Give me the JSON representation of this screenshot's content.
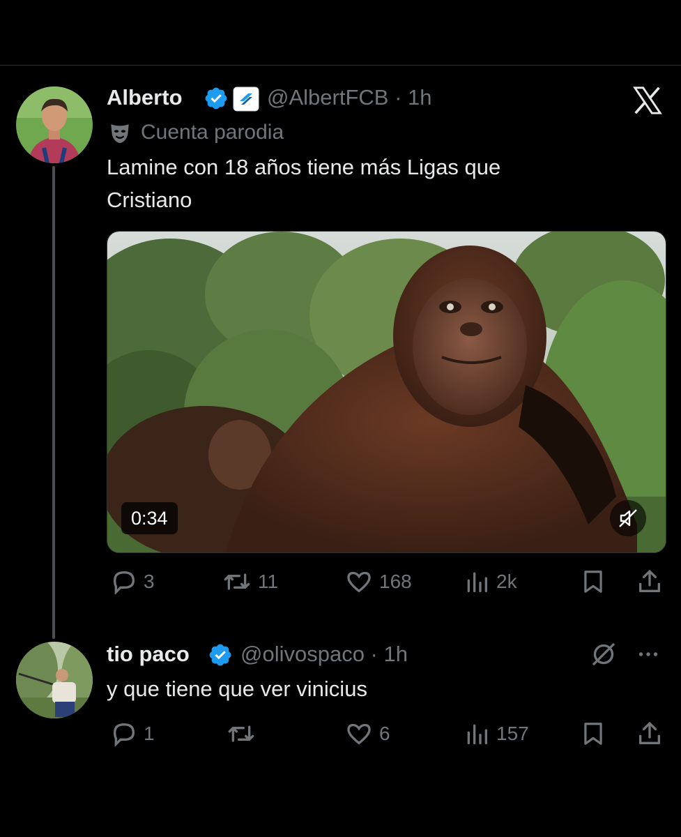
{
  "tweet": {
    "author_name": "Alberto",
    "handle_time": "@AlbertFCB · 1h",
    "parody_label": "Cuenta parodia",
    "text_line1": "Lamine con 18 años tiene más Ligas que",
    "text_line2": "Cristiano",
    "video_duration": "0:34",
    "replies": "3",
    "retweets": "11",
    "likes": "168",
    "views": "2k"
  },
  "reply": {
    "author_name": "tio paco",
    "handle_time": "@olivospaco · 1h",
    "text": "y que tiene que ver vinicius",
    "replies": "1",
    "retweets": "",
    "likes": "6",
    "views": "157"
  },
  "colors": {
    "background": "#000000",
    "text": "#e7e9ea",
    "muted": "#71767b",
    "verified": "#1d9bf0"
  },
  "icons": [
    "x-logo-icon",
    "verified-badge-icon",
    "affiliate-badge-icon",
    "parody-mask-icon",
    "reply-icon",
    "retweet-icon",
    "like-icon",
    "views-icon",
    "bookmark-icon",
    "share-icon",
    "mute-icon",
    "grok-icon",
    "more-icon"
  ]
}
